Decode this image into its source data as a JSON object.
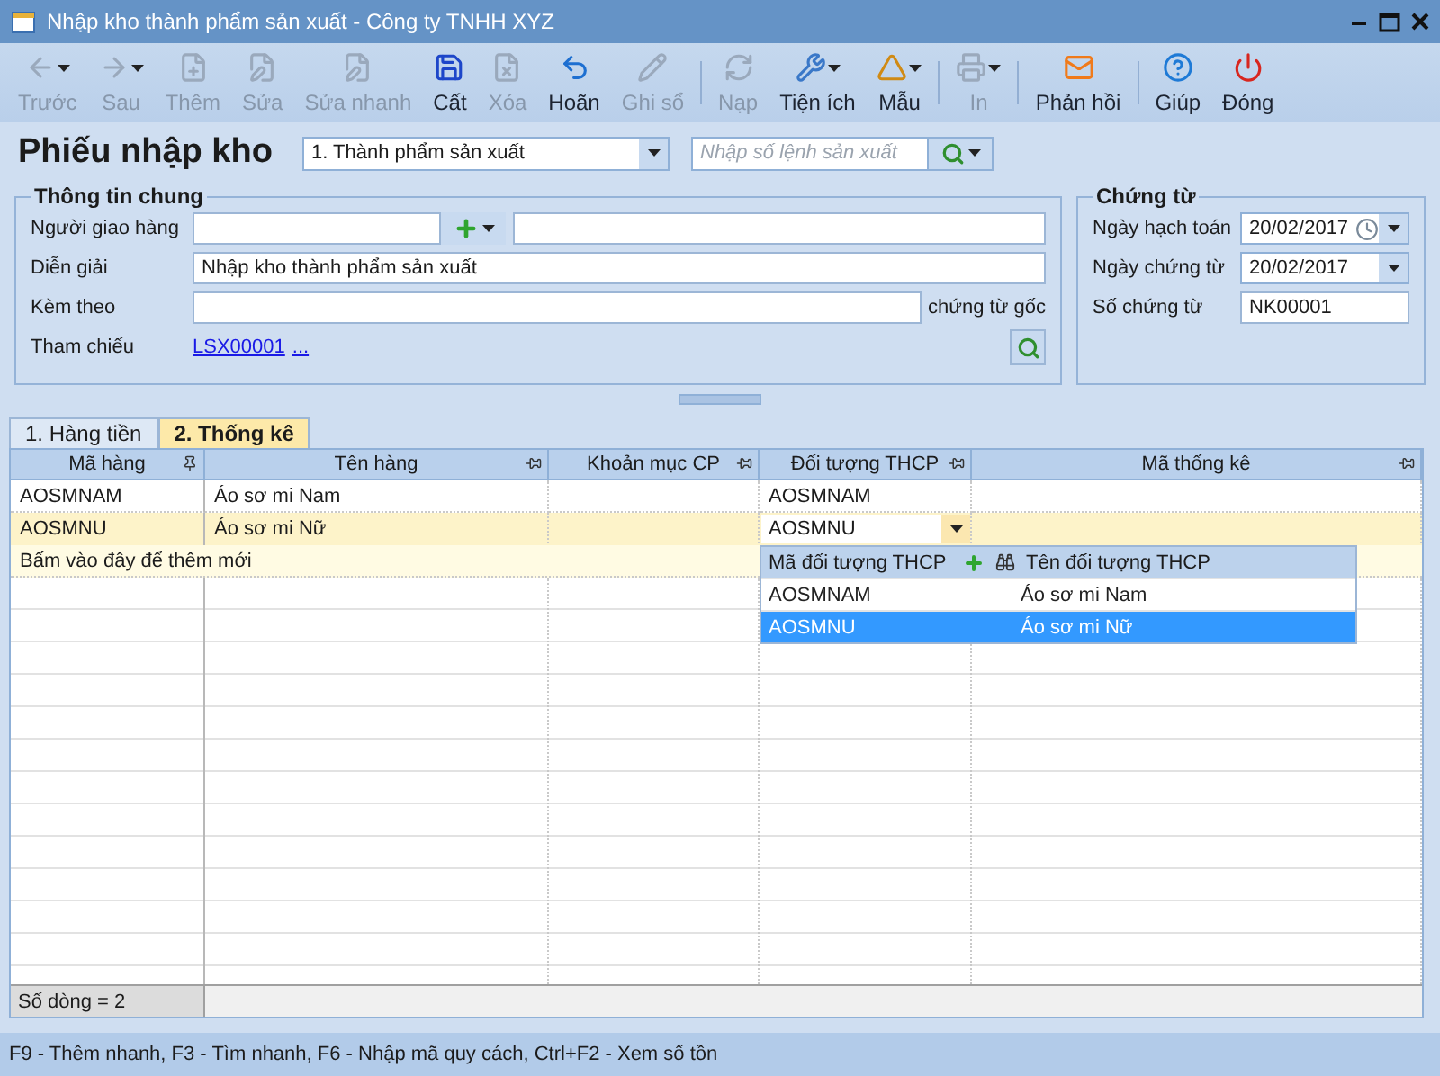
{
  "window": {
    "title": "Nhập kho thành phẩm sản xuất - Công ty TNHH XYZ"
  },
  "toolbar": [
    {
      "kind": "button",
      "label": "Trước",
      "disabled": true,
      "has_menu": true
    },
    {
      "kind": "button",
      "label": "Sau",
      "disabled": true,
      "has_menu": true
    },
    {
      "kind": "button",
      "label": "Thêm",
      "disabled": true,
      "has_menu": false
    },
    {
      "kind": "button",
      "label": "Sửa",
      "disabled": true,
      "has_menu": false
    },
    {
      "kind": "button",
      "label": "Sửa nhanh",
      "disabled": true,
      "has_menu": false
    },
    {
      "kind": "button",
      "label": "Cất",
      "disabled": false,
      "has_menu": false
    },
    {
      "kind": "button",
      "label": "Xóa",
      "disabled": true,
      "has_menu": false
    },
    {
      "kind": "button",
      "label": "Hoãn",
      "disabled": false,
      "has_menu": false
    },
    {
      "kind": "button",
      "label": "Ghi sổ",
      "disabled": true,
      "has_menu": false
    },
    {
      "kind": "separator"
    },
    {
      "kind": "button",
      "label": "Nạp",
      "disabled": true,
      "has_menu": false
    },
    {
      "kind": "button",
      "label": "Tiện ích",
      "disabled": false,
      "has_menu": true
    },
    {
      "kind": "button",
      "label": "Mẫu",
      "disabled": false,
      "has_menu": true
    },
    {
      "kind": "separator"
    },
    {
      "kind": "button",
      "label": "In",
      "disabled": true,
      "has_menu": true
    },
    {
      "kind": "separator"
    },
    {
      "kind": "button",
      "label": "Phản hồi",
      "disabled": false,
      "has_menu": false
    },
    {
      "kind": "separator"
    },
    {
      "kind": "button",
      "label": "Giúp",
      "disabled": false,
      "has_menu": false
    },
    {
      "kind": "button",
      "label": "Đóng",
      "disabled": false,
      "has_menu": false
    }
  ],
  "form": {
    "title": "Phiếu nhập kho",
    "type_select": {
      "value": "1. Thành phẩm sản xuất"
    },
    "order_search": {
      "placeholder": "Nhập số lệnh sản xuất"
    }
  },
  "general_info": {
    "title": "Thông tin chung",
    "fields": [
      {
        "kind": "lookup",
        "label": "Người giao hàng"
      },
      {
        "kind": "text",
        "label": "Diễn giải",
        "value": "Nhập kho thành phẩm sản xuất"
      },
      {
        "kind": "attach",
        "label": "Kèm theo",
        "suffix": "chứng từ gốc"
      },
      {
        "kind": "link",
        "label": "Tham chiếu",
        "link": "LSX00001",
        "more": "..."
      }
    ]
  },
  "voucher": {
    "title": "Chứng từ",
    "fields": [
      {
        "kind": "date_clock",
        "label": "Ngày hạch toán",
        "value": "20/02/2017"
      },
      {
        "kind": "date",
        "label": "Ngày chứng từ",
        "value": "20/02/2017"
      },
      {
        "kind": "text",
        "label": "Số chứng từ",
        "value": "NK00001"
      }
    ]
  },
  "tabs": [
    {
      "label": "1. Hàng tiền",
      "selected": false
    },
    {
      "label": "2. Thống kê",
      "selected": true
    }
  ],
  "grid": {
    "columns": [
      {
        "label": "Mã hàng",
        "pinned": true
      },
      {
        "label": "Tên hàng",
        "pinned": false
      },
      {
        "label": "Khoản mục CP",
        "pinned": false
      },
      {
        "label": "Đối tượng THCP",
        "pinned": false
      },
      {
        "label": "Mã thống kê",
        "pinned": false
      }
    ],
    "rows": [
      {
        "code": "AOSMNAM",
        "name": "Áo sơ mi Nam",
        "cost_object": "AOSMNAM",
        "selected": false,
        "editing": false
      },
      {
        "code": "AOSMNU",
        "name": "Áo sơ mi Nữ",
        "cost_object": "AOSMNU",
        "selected": true,
        "editing": true
      }
    ],
    "new_row_hint": "Bấm vào đây để thêm mới",
    "row_count": "Số dòng = 2"
  },
  "dropdown": {
    "columns": [
      "Mã đối tượng THCP",
      "Tên đối tượng THCP"
    ],
    "rows": [
      {
        "code": "AOSMNAM",
        "name": "Áo sơ mi Nam",
        "selected": false
      },
      {
        "code": "AOSMNU",
        "name": "Áo sơ mi Nữ",
        "selected": true
      }
    ]
  },
  "status_bar": "F9 - Thêm nhanh, F3 - Tìm nhanh, F6 - Nhập mã quy cách, Ctrl+F2 - Xem số tồn"
}
